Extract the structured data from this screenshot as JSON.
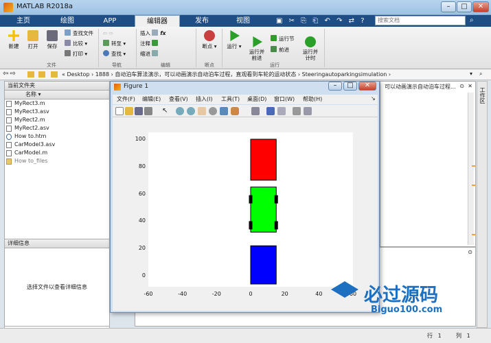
{
  "app": {
    "title": "MATLAB R2018a"
  },
  "tabs": [
    "主页",
    "绘图",
    "APP",
    "编辑器",
    "发布",
    "视图"
  ],
  "active_tab": "编辑器",
  "search": {
    "placeholder": "搜索文档"
  },
  "ribbon": {
    "file_group": {
      "label": "文件",
      "new": "新建",
      "open": "打开",
      "save": "保存",
      "find_files": "查找文件",
      "compare": "比较",
      "print": "打印"
    },
    "nav_group": {
      "label": "导航",
      "goto": "转至",
      "find": "查找"
    },
    "edit_group": {
      "label": "编辑",
      "insert": "插入",
      "comment": "注释",
      "indent": "缩进",
      "fx": "fx"
    },
    "breakpoint_group": {
      "label": "断点",
      "breakpoints": "断点"
    },
    "run_group": {
      "label": "运行",
      "run": "运行",
      "run_advance": "运行并\n前进",
      "run_section": "运行节",
      "advance": "前进",
      "run_time": "运行并\n计时"
    }
  },
  "address": {
    "path": "« Desktop › 1888 › 自动泊车算法演示，可以动画演示自动泊车过程，直观看到车轮的运动状态 › Steeringautoparkingsimulation ›"
  },
  "left_pane": {
    "header": "当前文件夹",
    "col_name": "名称",
    "files": [
      "MyRect3.m",
      "MyRect3.asv",
      "MyRect2.m",
      "MyRect2.asv",
      "How to.htm",
      "CarModel3.asv",
      "CarModel.m",
      "How to_files"
    ]
  },
  "details": {
    "header": "详细信息",
    "message": "选择文件以查看详细信息"
  },
  "right_pane": {
    "title_fragment": "可以动画演示自动泊车过程..."
  },
  "side_tab": "工作区",
  "figure": {
    "title": "Figure 1",
    "menus": [
      "文件(F)",
      "编辑(E)",
      "查看(V)",
      "插入(I)",
      "工具(T)",
      "桌面(D)",
      "窗口(W)",
      "帮助(H)"
    ]
  },
  "chart_data": {
    "type": "diagram",
    "xlim": [
      -60,
      60
    ],
    "ylim": [
      -8,
      105
    ],
    "xticks": [
      -60,
      -40,
      -20,
      0,
      20,
      40,
      60
    ],
    "yticks": [
      0,
      20,
      40,
      60,
      80,
      100
    ],
    "rects": [
      {
        "x0": 0,
        "x1": 15,
        "y0": 70,
        "y1": 100,
        "color": "#ff0000"
      },
      {
        "x0": 0,
        "x1": 15,
        "y0": 32,
        "y1": 65,
        "color": "#00ff00"
      },
      {
        "x0": 0,
        "x1": 15,
        "y0": -6,
        "y1": 22,
        "color": "#0000ff"
      }
    ],
    "wheels": [
      {
        "x": 0,
        "y": 56
      },
      {
        "x": 15,
        "y": 56
      },
      {
        "x": 0,
        "y": 37
      },
      {
        "x": 15,
        "y": 37
      }
    ]
  },
  "status": {
    "row_label": "行",
    "row": "1",
    "col_label": "列",
    "col": "1"
  },
  "watermark": {
    "text": "必过源码",
    "url": "Biguo100.com"
  }
}
